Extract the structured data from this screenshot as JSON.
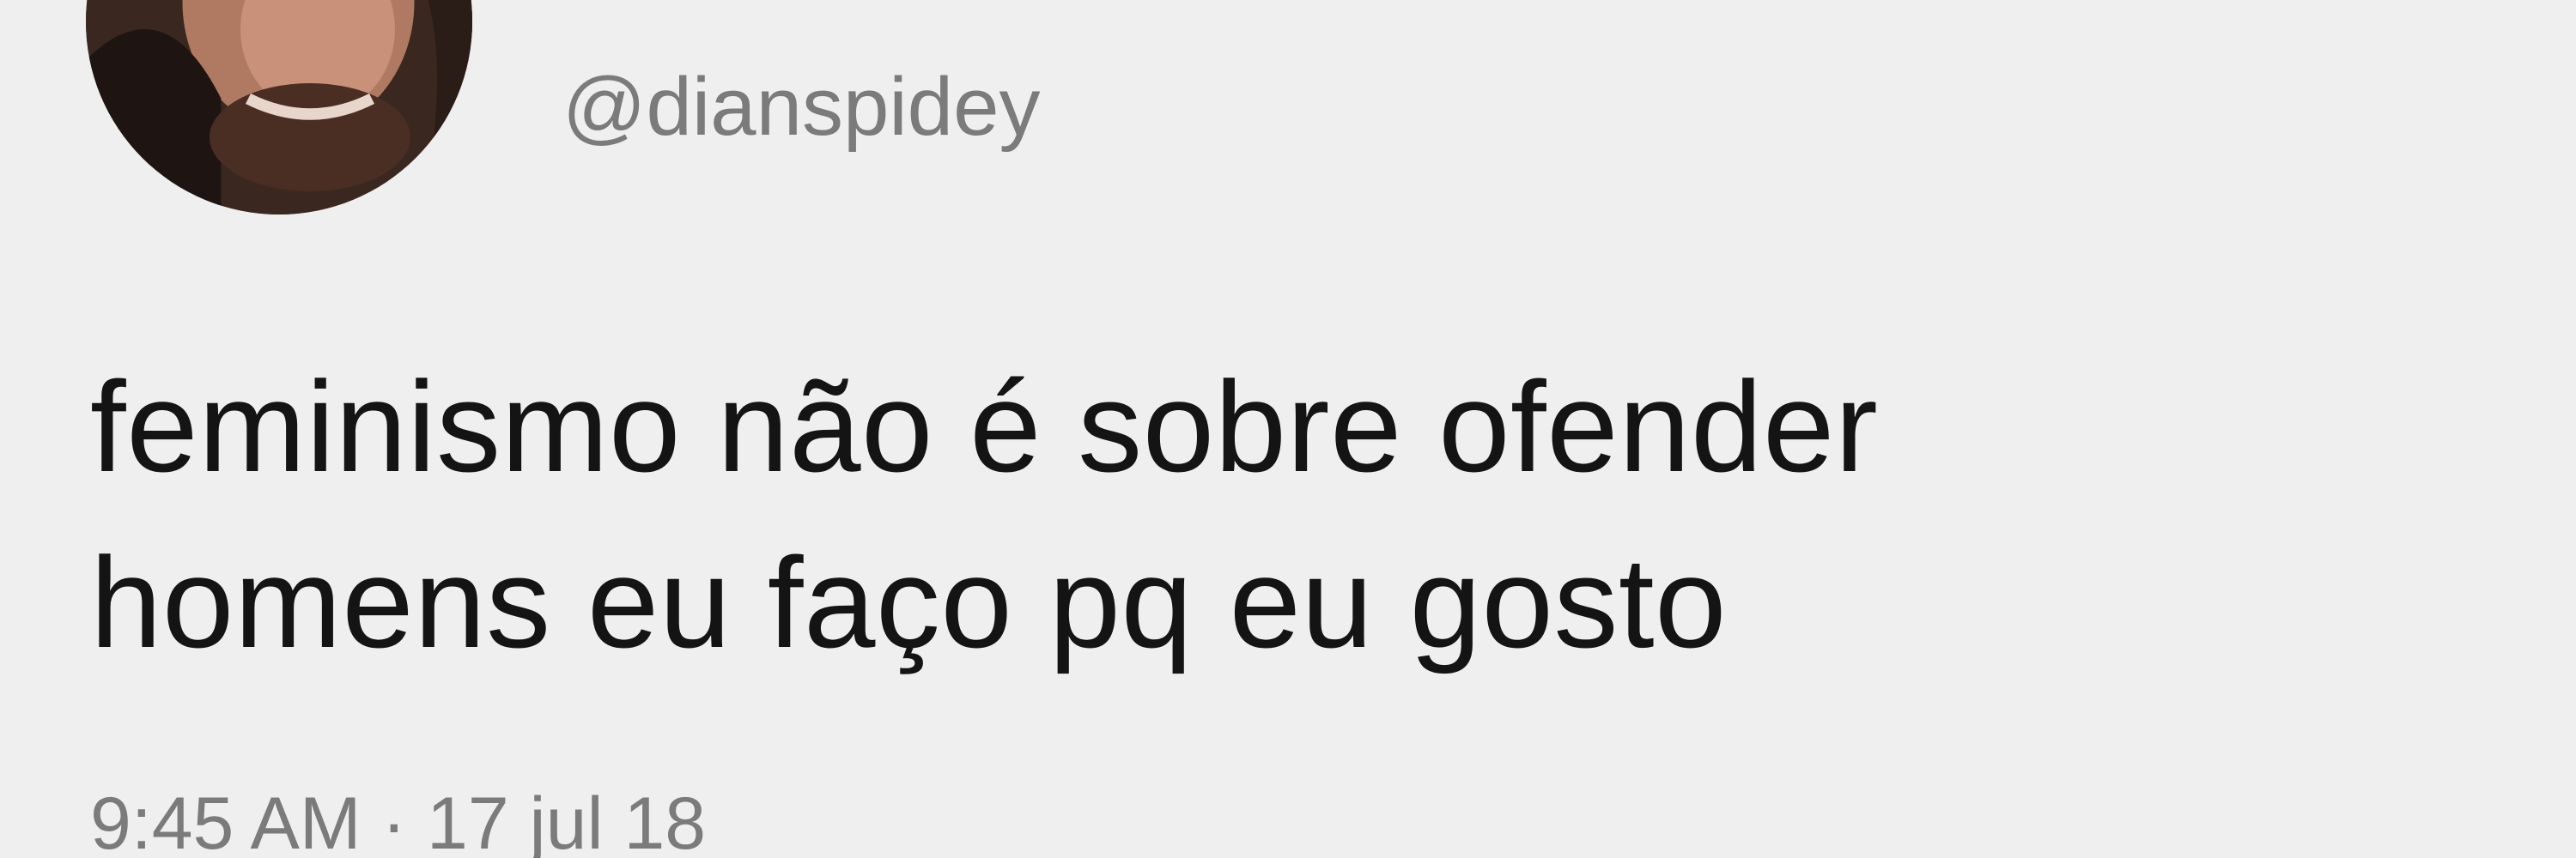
{
  "tweet": {
    "avatar_alt": "avatar",
    "handle": "@dianspidey",
    "text_lines": [
      "feminismo não é sobre ofender",
      "homens eu faço pq eu gosto"
    ],
    "time": "9:45 AM",
    "separator": "·",
    "date": "17 jul 18"
  },
  "colors": {
    "background": "#efefef",
    "text": "#141414",
    "secondary_text": "#7b7b7b"
  }
}
